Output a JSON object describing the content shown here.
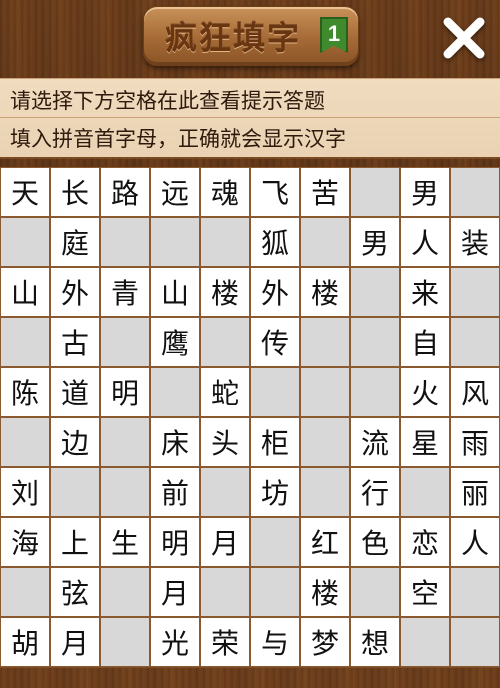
{
  "header": {
    "title": "疯狂填字",
    "level": "1",
    "close_icon": "close-icon"
  },
  "hints": {
    "line1": "请选择下方空格在此查看提示答题",
    "line2": "填入拼音首字母，正确就会显示汉字"
  },
  "colors": {
    "wood": "#6b3d1b",
    "panel": "#efd9bc",
    "cell_filled": "#ffffff",
    "cell_empty": "#d8d8d8",
    "badge": "#3f8a2c"
  },
  "grid": [
    [
      "天",
      "长",
      "路",
      "远",
      "魂",
      "飞",
      "苦",
      "",
      "男",
      ""
    ],
    [
      "",
      "庭",
      "",
      "",
      "",
      "狐",
      "",
      "男",
      "人",
      "装"
    ],
    [
      "山",
      "外",
      "青",
      "山",
      "楼",
      "外",
      "楼",
      "",
      "来",
      ""
    ],
    [
      "",
      "古",
      "",
      "鹰",
      "",
      "传",
      "",
      "",
      "自",
      ""
    ],
    [
      "陈",
      "道",
      "明",
      "",
      "蛇",
      "",
      "",
      "",
      "火",
      "风"
    ],
    [
      "",
      "边",
      "",
      "床",
      "头",
      "柜",
      "",
      "流",
      "星",
      "雨"
    ],
    [
      "刘",
      "",
      "",
      "前",
      "",
      "坊",
      "",
      "行",
      "",
      "丽"
    ],
    [
      "海",
      "上",
      "生",
      "明",
      "月",
      "",
      "红",
      "色",
      "恋",
      "人"
    ],
    [
      "",
      "弦",
      "",
      "月",
      "",
      "",
      "楼",
      "",
      "空",
      ""
    ],
    [
      "胡",
      "月",
      "",
      "光",
      "荣",
      "与",
      "梦",
      "想",
      "",
      ""
    ]
  ]
}
